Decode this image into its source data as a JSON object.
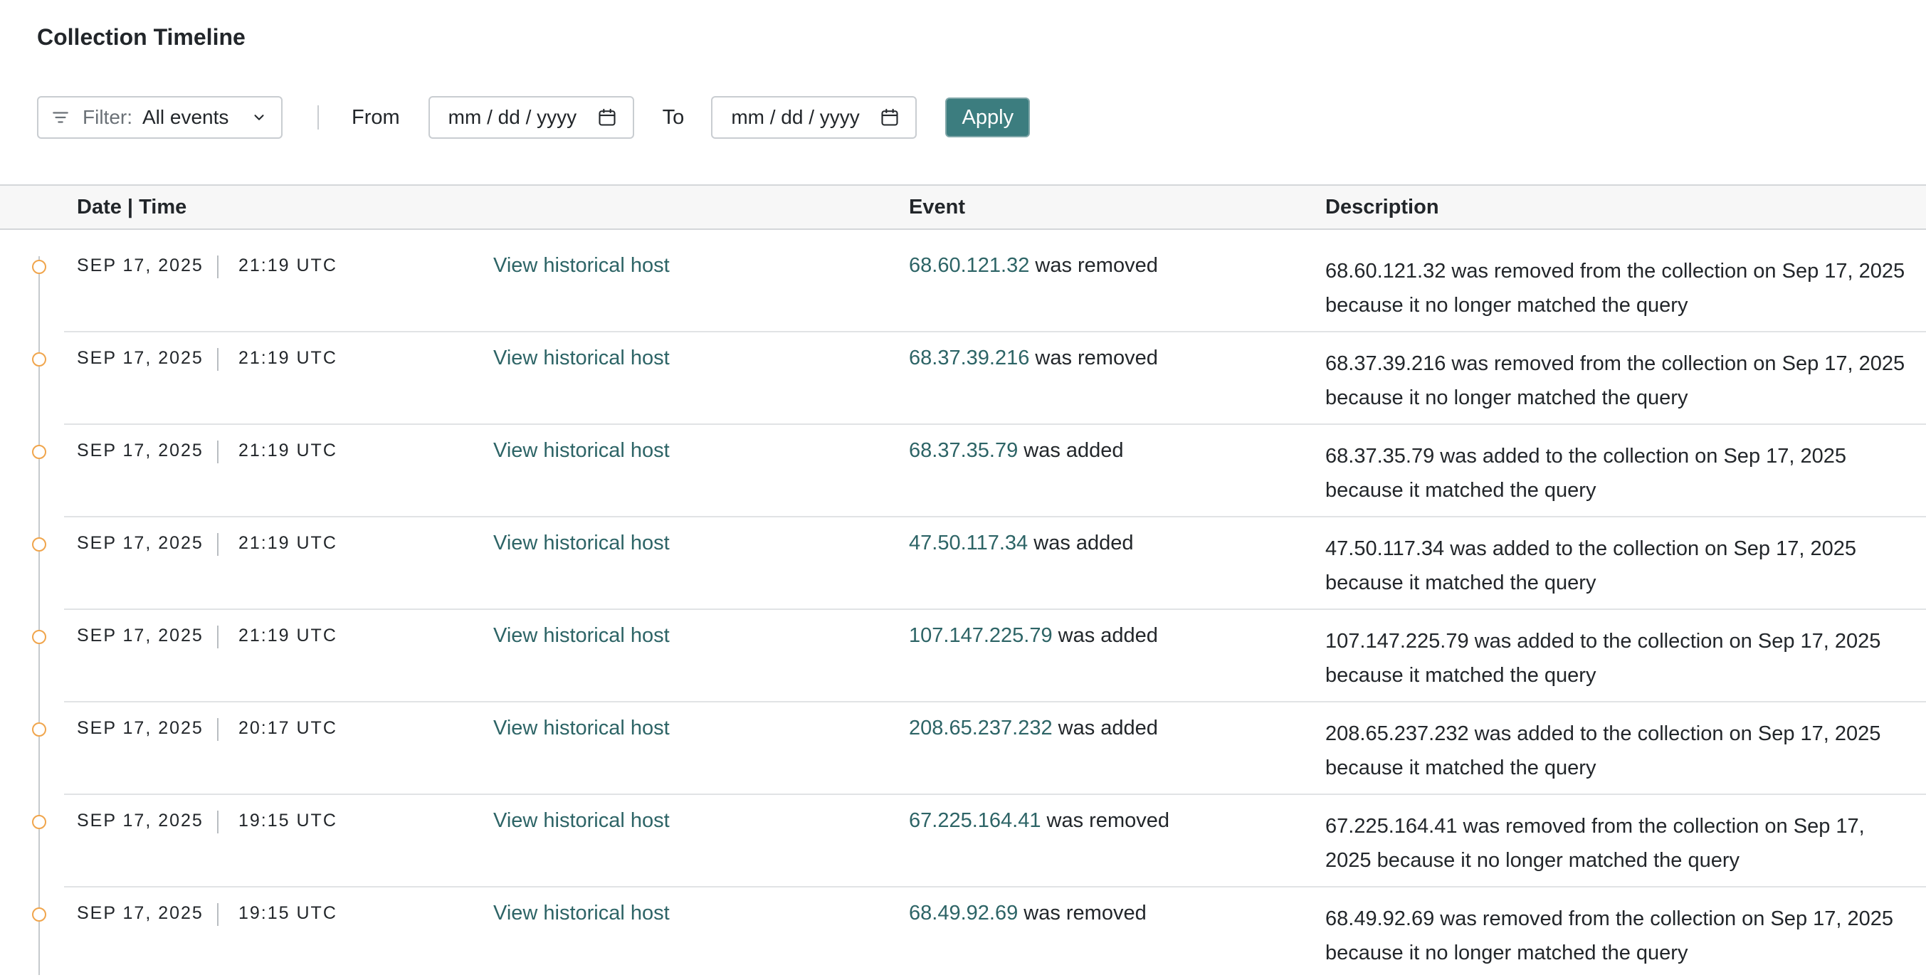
{
  "page": {
    "title": "Collection Timeline"
  },
  "toolbar": {
    "filter_label": "Filter:",
    "filter_value": "All events",
    "from_label": "From",
    "to_label": "To",
    "date_from_placeholder": "mm / dd / yyyy",
    "date_to_placeholder": "mm / dd / yyyy",
    "apply_label": "Apply"
  },
  "table": {
    "headers": {
      "datetime": "Date | Time",
      "event": "Event",
      "description": "Description"
    },
    "rows": [
      {
        "date": "SEP 17, 2025",
        "time": "21:19 UTC",
        "link": "View historical host",
        "ip": "68.60.121.32",
        "action": " was removed",
        "description": "68.60.121.32 was removed from the collection on Sep 17, 2025 because it no longer matched the query"
      },
      {
        "date": "SEP 17, 2025",
        "time": "21:19 UTC",
        "link": "View historical host",
        "ip": "68.37.39.216",
        "action": " was removed",
        "description": "68.37.39.216 was removed from the collection on Sep 17, 2025 because it no longer matched the query"
      },
      {
        "date": "SEP 17, 2025",
        "time": "21:19 UTC",
        "link": "View historical host",
        "ip": "68.37.35.79",
        "action": " was added",
        "description": "68.37.35.79 was added to the collection on Sep 17, 2025 because it matched the query"
      },
      {
        "date": "SEP 17, 2025",
        "time": "21:19 UTC",
        "link": "View historical host",
        "ip": "47.50.117.34",
        "action": " was added",
        "description": "47.50.117.34 was added to the collection on Sep 17, 2025 because it matched the query"
      },
      {
        "date": "SEP 17, 2025",
        "time": "21:19 UTC",
        "link": "View historical host",
        "ip": "107.147.225.79",
        "action": " was added",
        "description": "107.147.225.79 was added to the collection on Sep 17, 2025 because it matched the query"
      },
      {
        "date": "SEP 17, 2025",
        "time": "20:17 UTC",
        "link": "View historical host",
        "ip": "208.65.237.232",
        "action": " was added",
        "description": "208.65.237.232 was added to the collection on Sep 17, 2025 because it matched the query"
      },
      {
        "date": "SEP 17, 2025",
        "time": "19:15 UTC",
        "link": "View historical host",
        "ip": "67.225.164.41",
        "action": " was removed",
        "description": "67.225.164.41 was removed from the collection on Sep 17, 2025 because it no longer matched the query"
      },
      {
        "date": "SEP 17, 2025",
        "time": "19:15 UTC",
        "link": "View historical host",
        "ip": "68.49.92.69",
        "action": " was removed",
        "description": "68.49.92.69 was removed from the collection on Sep 17, 2025 because it no longer matched the query"
      }
    ]
  },
  "colors": {
    "accent": "#3c7d7f",
    "link": "#2d6466",
    "timeline_dot": "#f0a54c"
  },
  "icons": {
    "filter": "filter-icon",
    "chevron": "chevron-down-icon",
    "calendar": "calendar-icon"
  }
}
